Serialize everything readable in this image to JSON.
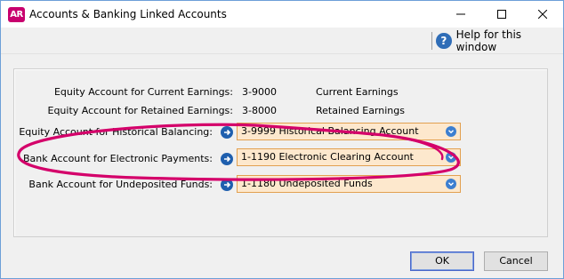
{
  "window": {
    "app_icon_text": "AR",
    "title": "Accounts & Banking Linked Accounts"
  },
  "helpbar": {
    "help_label": "Help for this window",
    "help_icon_glyph": "?"
  },
  "rows": [
    {
      "label": "Equity Account for Current Earnings:",
      "code": "3-9000",
      "name": "Current Earnings"
    },
    {
      "label": "Equity Account for Retained Earnings:",
      "code": "3-8000",
      "name": "Retained Earnings"
    },
    {
      "label": "Equity Account for Historical Balancing:",
      "value": "3-9999 Historical Balancing Account"
    },
    {
      "label": "Bank Account for Electronic Payments:",
      "value": "1-1190 Electronic Clearing Account"
    },
    {
      "label": "Bank Account for Undeposited Funds:",
      "value": "1-1180 Undeposited Funds"
    }
  ],
  "buttons": {
    "ok": "OK",
    "cancel": "Cancel"
  },
  "colors": {
    "app_icon": "#c8006e",
    "combo_fill": "#fde8cd",
    "combo_border": "#e2a050",
    "arrow_button": "#1f5fae",
    "annotation": "#d4006a"
  },
  "icons": {
    "minimize": "minimize-icon",
    "maximize": "maximize-icon",
    "close": "close-icon",
    "help": "help-icon",
    "link_arrow": "arrow-right-circle-icon",
    "dropdown": "chevron-down-circle-icon"
  }
}
